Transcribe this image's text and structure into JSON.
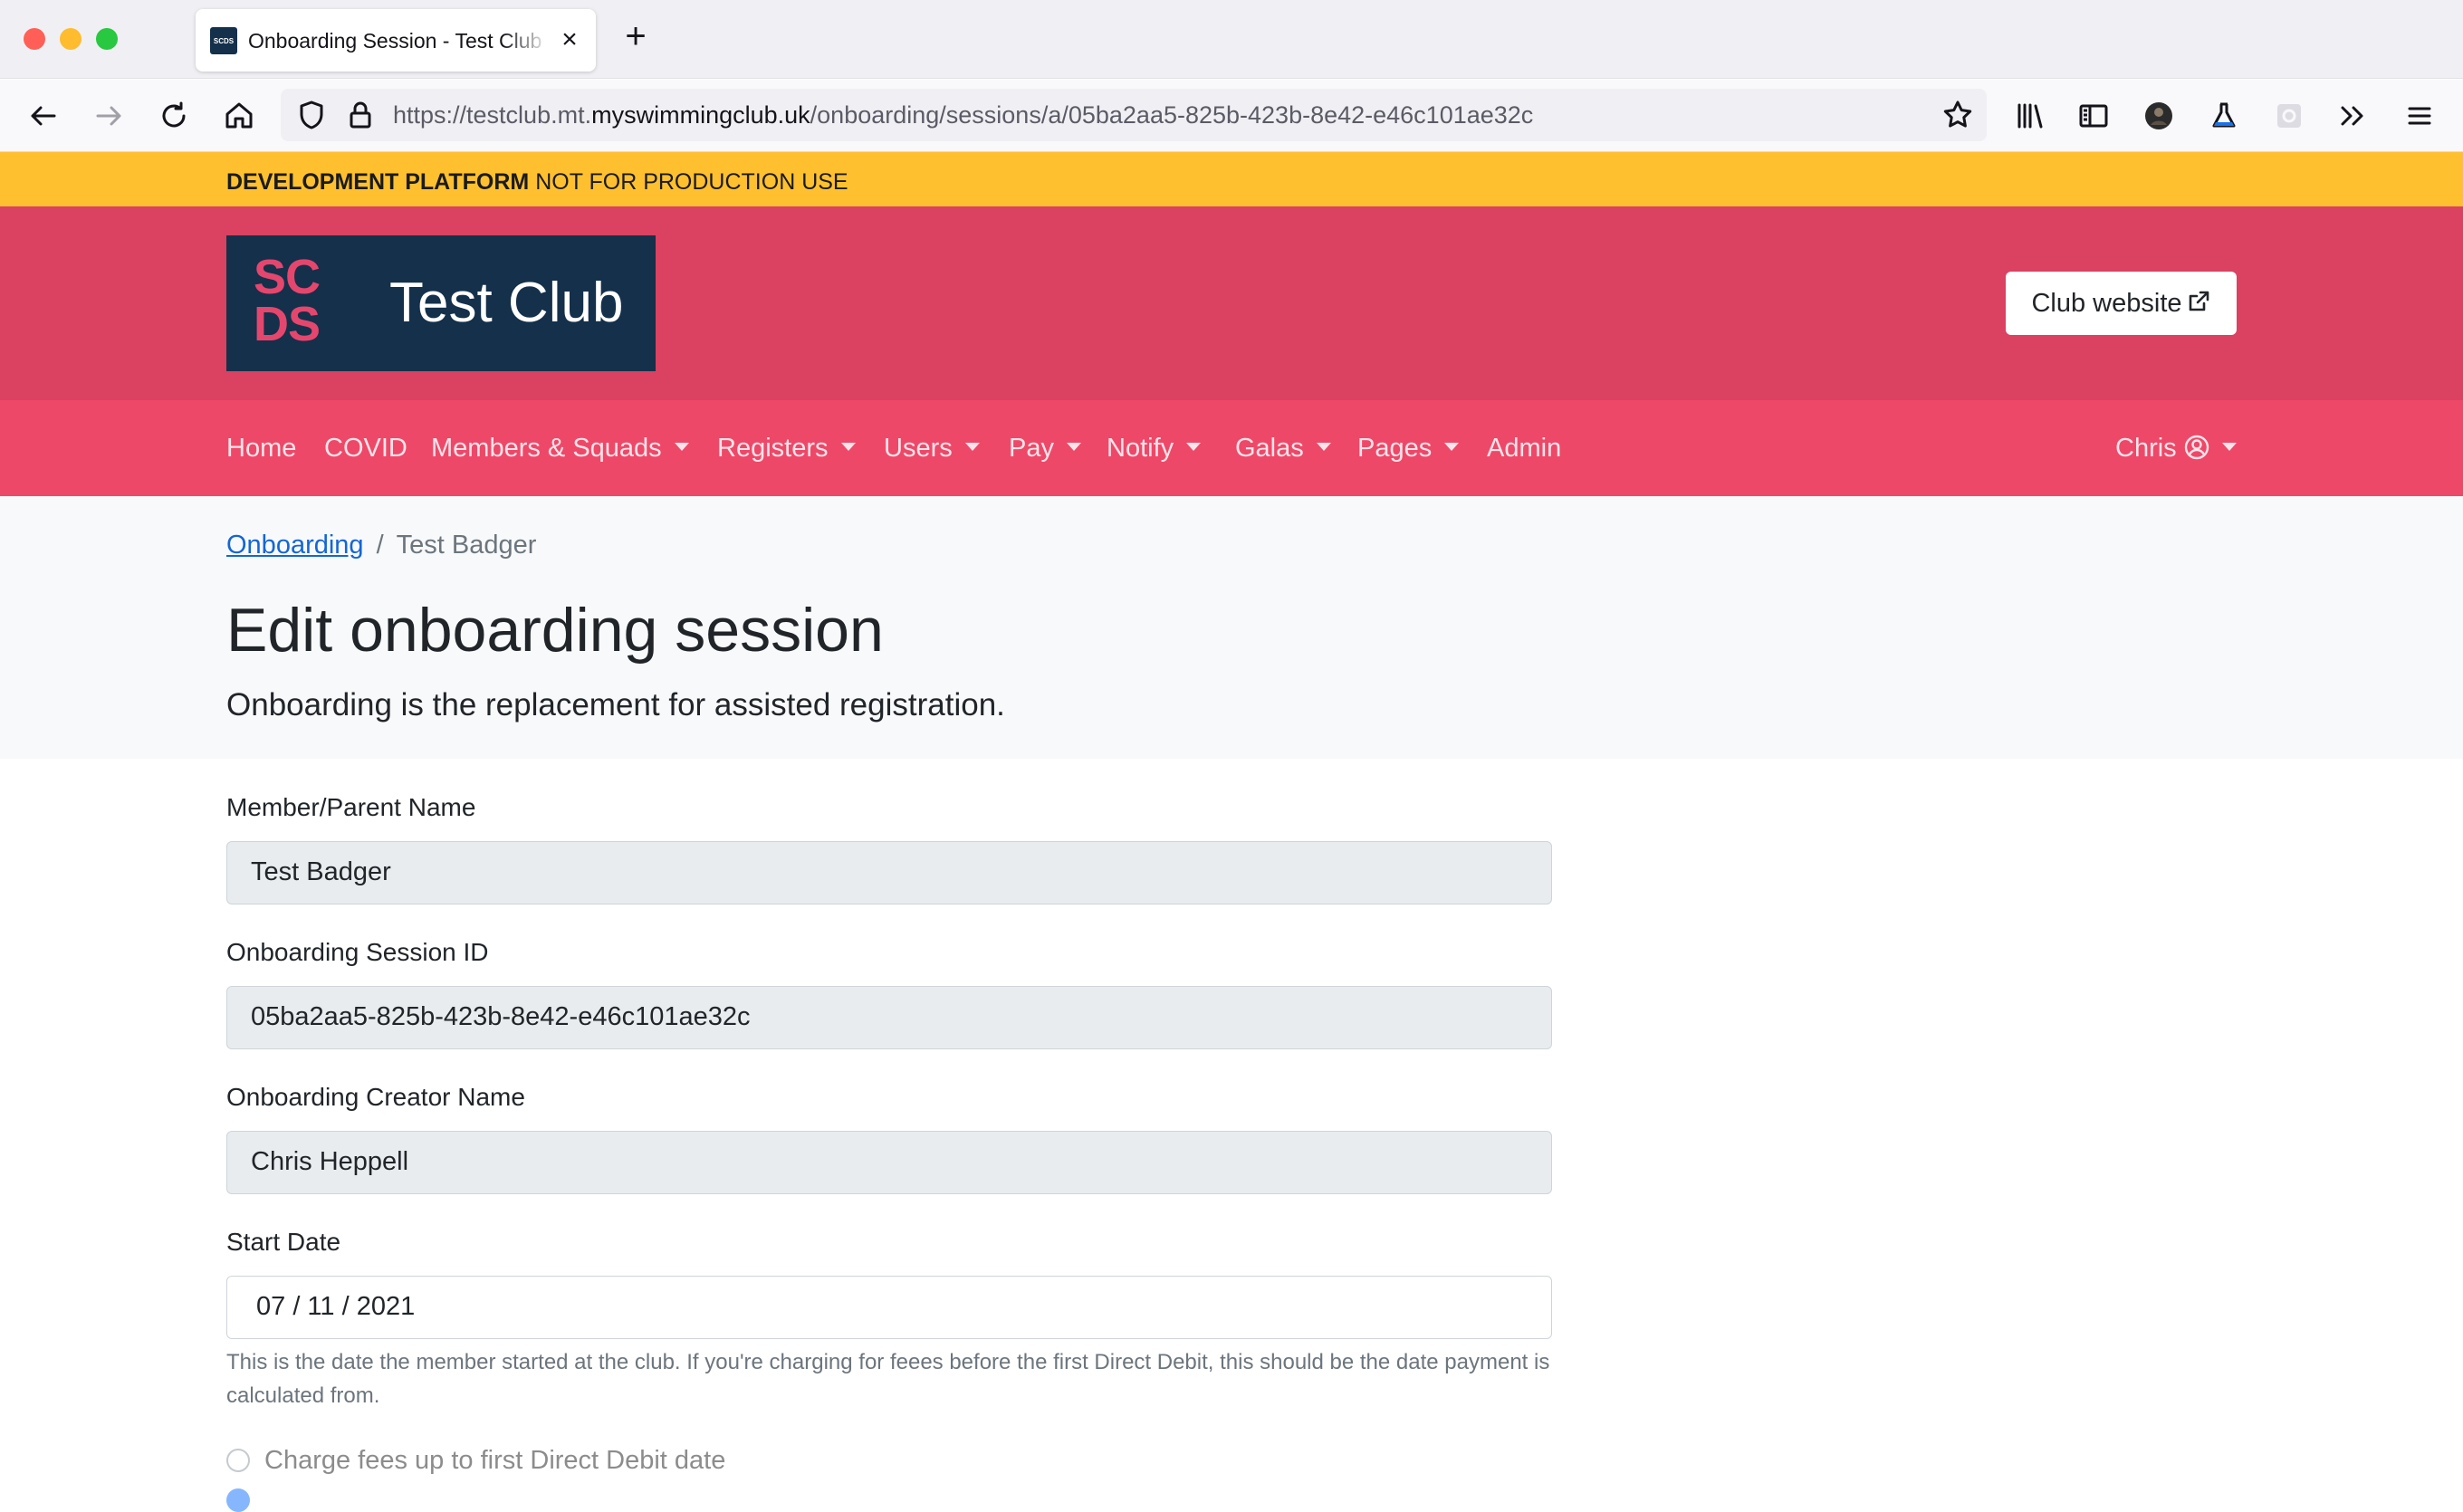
{
  "browser": {
    "tab_title": "Onboarding Session - Test Club",
    "tab_favicon_text": "SCDS",
    "url_prefix": "https://testclub.mt.",
    "url_host": "myswimmingclub.uk",
    "url_path": "/onboarding/sessions/a/05ba2aa5-825b-423b-8e42-e46c101ae32c"
  },
  "dev_banner": {
    "bold": "DEVELOPMENT PLATFORM",
    "text": " NOT FOR PRODUCTION USE"
  },
  "header": {
    "logo_mark_line1": "SC",
    "logo_mark_line2": "DS",
    "club_name": "Test Club",
    "club_website_button": "Club website"
  },
  "nav": {
    "home": "Home",
    "covid": "COVID",
    "members_squads": "Members & Squads",
    "registers": "Registers",
    "users": "Users",
    "pay": "Pay",
    "notify": "Notify",
    "galas": "Galas",
    "pages": "Pages",
    "admin": "Admin",
    "user": "Chris"
  },
  "breadcrumb": {
    "parent": "Onboarding",
    "current": "Test Badger"
  },
  "page": {
    "title": "Edit onboarding session",
    "lead": "Onboarding is the replacement for assisted registration."
  },
  "form": {
    "member_name_label": "Member/Parent Name",
    "member_name_value": "Test Badger",
    "session_id_label": "Onboarding Session ID",
    "session_id_value": "05ba2aa5-825b-423b-8e42-e46c101ae32c",
    "creator_label": "Onboarding Creator Name",
    "creator_value": "Chris Heppell",
    "start_date_label": "Start Date",
    "start_date_value": "07 / 11 / 2021",
    "start_date_help": "This is the date the member started at the club. If you're charging for feees before the first Direct Debit, this should be the date payment is calculated from.",
    "radio_charge_label": "Charge fees up to first Direct Debit date"
  },
  "colors": {
    "dev_banner": "#ffc030",
    "header": "#db4161",
    "nav": "#ee4868",
    "logo_bg": "#14304b",
    "link": "#1366d6"
  }
}
